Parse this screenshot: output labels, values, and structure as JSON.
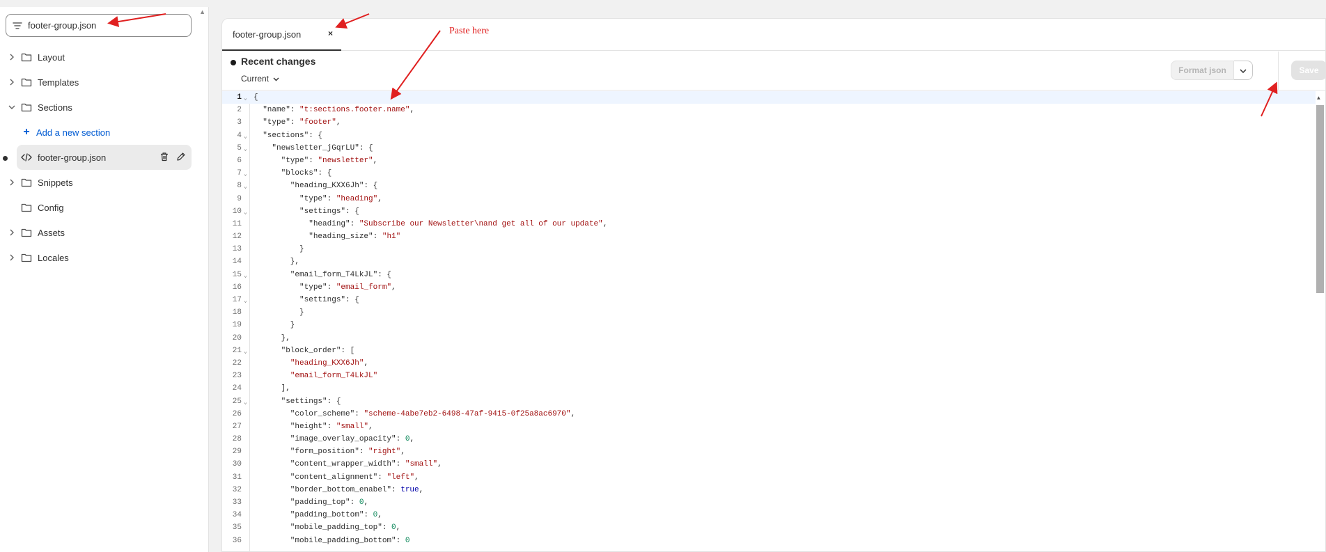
{
  "search": {
    "value": "footer-group.json"
  },
  "tree": {
    "layout": "Layout",
    "templates": "Templates",
    "sections": "Sections",
    "add_section": "Add a new section",
    "active_file": "footer-group.json",
    "snippets": "Snippets",
    "config": "Config",
    "assets": "Assets",
    "locales": "Locales"
  },
  "tabs": [
    {
      "label": "footer-group.json",
      "close": "×"
    }
  ],
  "toolbar": {
    "recent_changes": "Recent changes",
    "version": "Current",
    "format_label": "Format json",
    "save_label": "Save"
  },
  "annotation": {
    "paste_label": "Paste here"
  },
  "code": [
    {
      "n": "1",
      "fold": true,
      "t": [
        [
          "p",
          "{"
        ]
      ]
    },
    {
      "n": "2",
      "t": [
        [
          "p",
          "  \"name\": "
        ],
        [
          "s",
          "\"t:sections.footer.name\""
        ],
        [
          "p",
          ","
        ]
      ]
    },
    {
      "n": "3",
      "t": [
        [
          "p",
          "  \"type\": "
        ],
        [
          "s",
          "\"footer\""
        ],
        [
          "p",
          ","
        ]
      ]
    },
    {
      "n": "4",
      "fold": true,
      "t": [
        [
          "p",
          "  \"sections\": {"
        ]
      ]
    },
    {
      "n": "5",
      "fold": true,
      "t": [
        [
          "p",
          "    \"newsletter_jGqrLU\": {"
        ]
      ]
    },
    {
      "n": "6",
      "t": [
        [
          "p",
          "      \"type\": "
        ],
        [
          "s",
          "\"newsletter\""
        ],
        [
          "p",
          ","
        ]
      ]
    },
    {
      "n": "7",
      "fold": true,
      "t": [
        [
          "p",
          "      \"blocks\": {"
        ]
      ]
    },
    {
      "n": "8",
      "fold": true,
      "t": [
        [
          "p",
          "        \"heading_KXX6Jh\": {"
        ]
      ]
    },
    {
      "n": "9",
      "t": [
        [
          "p",
          "          \"type\": "
        ],
        [
          "s",
          "\"heading\""
        ],
        [
          "p",
          ","
        ]
      ]
    },
    {
      "n": "10",
      "fold": true,
      "t": [
        [
          "p",
          "          \"settings\": {"
        ]
      ]
    },
    {
      "n": "11",
      "t": [
        [
          "p",
          "            \"heading\": "
        ],
        [
          "s",
          "\"Subscribe our Newsletter\\nand get all of our update\""
        ],
        [
          "p",
          ","
        ]
      ]
    },
    {
      "n": "12",
      "t": [
        [
          "p",
          "            \"heading_size\": "
        ],
        [
          "s",
          "\"h1\""
        ]
      ]
    },
    {
      "n": "13",
      "t": [
        [
          "p",
          "          }"
        ]
      ]
    },
    {
      "n": "14",
      "t": [
        [
          "p",
          "        },"
        ]
      ]
    },
    {
      "n": "15",
      "fold": true,
      "t": [
        [
          "p",
          "        \"email_form_T4LkJL\": {"
        ]
      ]
    },
    {
      "n": "16",
      "t": [
        [
          "p",
          "          \"type\": "
        ],
        [
          "s",
          "\"email_form\""
        ],
        [
          "p",
          ","
        ]
      ]
    },
    {
      "n": "17",
      "fold": true,
      "t": [
        [
          "p",
          "          \"settings\": {"
        ]
      ]
    },
    {
      "n": "18",
      "t": [
        [
          "p",
          "          }"
        ]
      ]
    },
    {
      "n": "19",
      "t": [
        [
          "p",
          "        }"
        ]
      ]
    },
    {
      "n": "20",
      "t": [
        [
          "p",
          "      },"
        ]
      ]
    },
    {
      "n": "21",
      "fold": true,
      "t": [
        [
          "p",
          "      \"block_order\": ["
        ]
      ]
    },
    {
      "n": "22",
      "t": [
        [
          "p",
          "        "
        ],
        [
          "s",
          "\"heading_KXX6Jh\""
        ],
        [
          "p",
          ","
        ]
      ]
    },
    {
      "n": "23",
      "t": [
        [
          "p",
          "        "
        ],
        [
          "s",
          "\"email_form_T4LkJL\""
        ]
      ]
    },
    {
      "n": "24",
      "t": [
        [
          "p",
          "      ],"
        ]
      ]
    },
    {
      "n": "25",
      "fold": true,
      "t": [
        [
          "p",
          "      \"settings\": {"
        ]
      ]
    },
    {
      "n": "26",
      "t": [
        [
          "p",
          "        \"color_scheme\": "
        ],
        [
          "s",
          "\"scheme-4abe7eb2-6498-47af-9415-0f25a8ac6970\""
        ],
        [
          "p",
          ","
        ]
      ]
    },
    {
      "n": "27",
      "t": [
        [
          "p",
          "        \"height\": "
        ],
        [
          "s",
          "\"small\""
        ],
        [
          "p",
          ","
        ]
      ]
    },
    {
      "n": "28",
      "t": [
        [
          "p",
          "        \"image_overlay_opacity\": "
        ],
        [
          "n",
          "0"
        ],
        [
          "p",
          ","
        ]
      ]
    },
    {
      "n": "29",
      "t": [
        [
          "p",
          "        \"form_position\": "
        ],
        [
          "s",
          "\"right\""
        ],
        [
          "p",
          ","
        ]
      ]
    },
    {
      "n": "30",
      "t": [
        [
          "p",
          "        \"content_wrapper_width\": "
        ],
        [
          "s",
          "\"small\""
        ],
        [
          "p",
          ","
        ]
      ]
    },
    {
      "n": "31",
      "t": [
        [
          "p",
          "        \"content_alignment\": "
        ],
        [
          "s",
          "\"left\""
        ],
        [
          "p",
          ","
        ]
      ]
    },
    {
      "n": "32",
      "t": [
        [
          "p",
          "        \"border_bottom_enabel\": "
        ],
        [
          "k",
          "true"
        ],
        [
          "p",
          ","
        ]
      ]
    },
    {
      "n": "33",
      "t": [
        [
          "p",
          "        \"padding_top\": "
        ],
        [
          "n",
          "0"
        ],
        [
          "p",
          ","
        ]
      ]
    },
    {
      "n": "34",
      "t": [
        [
          "p",
          "        \"padding_bottom\": "
        ],
        [
          "n",
          "0"
        ],
        [
          "p",
          ","
        ]
      ]
    },
    {
      "n": "35",
      "t": [
        [
          "p",
          "        \"mobile_padding_top\": "
        ],
        [
          "n",
          "0"
        ],
        [
          "p",
          ","
        ]
      ]
    },
    {
      "n": "36",
      "t": [
        [
          "p",
          "        \"mobile_padding_bottom\": "
        ],
        [
          "n",
          "0"
        ]
      ]
    }
  ]
}
